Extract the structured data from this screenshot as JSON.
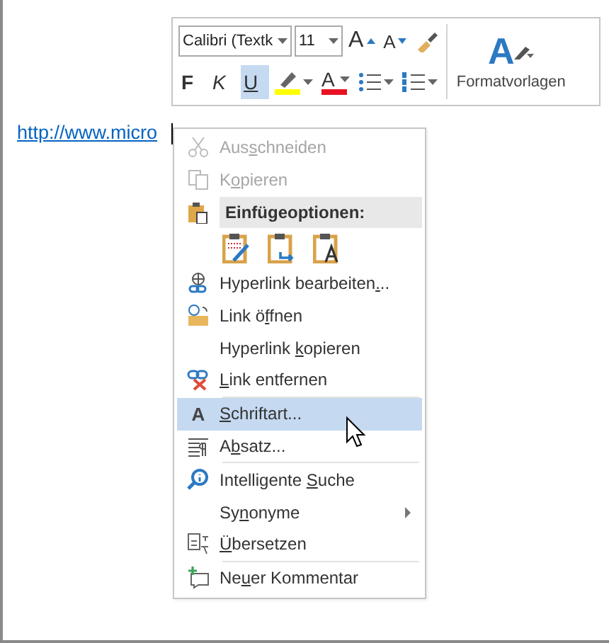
{
  "toolbar": {
    "font": "Calibri (Textk",
    "size": "11",
    "row1": [
      {
        "kind": "grow",
        "glyph": "A"
      },
      {
        "kind": "shrink",
        "glyph": "A"
      },
      {
        "kind": "painter"
      }
    ],
    "row2": [
      {
        "kind": "bold",
        "glyph": "F",
        "selected": false
      },
      {
        "kind": "italic",
        "glyph": "K",
        "selected": false
      },
      {
        "kind": "underline",
        "glyph": "U",
        "selected": true
      },
      {
        "kind": "highlight",
        "color": "#ffff00"
      },
      {
        "kind": "fontcolor",
        "glyph": "A",
        "color": "#e81123"
      },
      {
        "kind": "bullets"
      },
      {
        "kind": "numbering"
      }
    ],
    "styles": {
      "glyph": "A",
      "label": "Formatvorlagen"
    }
  },
  "document": {
    "link": "http://www.micro"
  },
  "menu": [
    {
      "kind": "item",
      "pre": "Aus",
      "key": "s",
      "post": "chneiden",
      "disabled": true,
      "selected": false,
      "submenu": false
    },
    {
      "kind": "item",
      "pre": "K",
      "key": "o",
      "post": "pieren",
      "disabled": true,
      "selected": false,
      "submenu": false
    },
    {
      "kind": "header",
      "label": "Einfügeoptionen:"
    },
    {
      "kind": "paste-options"
    },
    {
      "kind": "item",
      "pre": "Hyperlink bearbeiten",
      "key": ".",
      "post": "..",
      "disabled": false,
      "selected": false,
      "submenu": false
    },
    {
      "kind": "item",
      "pre": "Link ö",
      "key": "f",
      "post": "fnen",
      "disabled": false,
      "selected": false,
      "submenu": false
    },
    {
      "kind": "item",
      "pre": "Hyperlink ",
      "key": "k",
      "post": "opieren",
      "disabled": false,
      "selected": false,
      "submenu": false
    },
    {
      "kind": "item",
      "key": "L",
      "post": "ink entfernen",
      "disabled": false,
      "selected": false,
      "submenu": false
    },
    {
      "kind": "divider"
    },
    {
      "kind": "item",
      "glyph": "A",
      "key": "S",
      "post": "chriftart...",
      "disabled": false,
      "selected": true,
      "submenu": false
    },
    {
      "kind": "item",
      "pre": "A",
      "key": "b",
      "post": "satz...",
      "disabled": false,
      "selected": false,
      "submenu": false
    },
    {
      "kind": "divider"
    },
    {
      "kind": "item",
      "pre": "Intelligente ",
      "key": "S",
      "post": "uche",
      "disabled": false,
      "selected": false,
      "submenu": false
    },
    {
      "kind": "item",
      "pre": "Sy",
      "key": "n",
      "post": "onyme",
      "disabled": false,
      "selected": false,
      "submenu": true
    },
    {
      "kind": "item",
      "key": "Ü",
      "post": "bersetzen",
      "disabled": false,
      "selected": false,
      "submenu": false
    },
    {
      "kind": "divider"
    },
    {
      "kind": "item",
      "pre": "Ne",
      "key": "u",
      "post": "er Kommentar",
      "disabled": false,
      "selected": false,
      "submenu": false
    }
  ]
}
